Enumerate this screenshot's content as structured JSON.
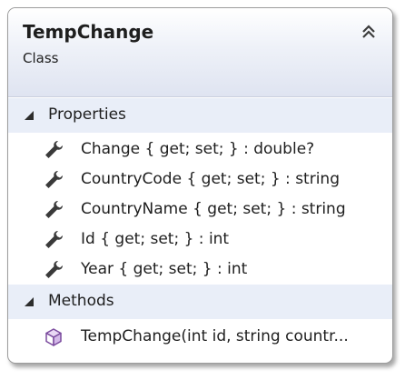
{
  "class": {
    "name": "TempChange",
    "kind": "Class",
    "collapse_icon": "double-chevron-up-icon"
  },
  "sections": {
    "properties": {
      "label": "Properties",
      "items": [
        {
          "text": "Change { get; set; } : double?",
          "icon": "wrench-icon"
        },
        {
          "text": "CountryCode { get; set; } : string",
          "icon": "wrench-icon"
        },
        {
          "text": "CountryName { get; set; } : string",
          "icon": "wrench-icon"
        },
        {
          "text": "Id { get; set; } : int",
          "icon": "wrench-icon"
        },
        {
          "text": "Year { get; set; } : int",
          "icon": "wrench-icon"
        }
      ]
    },
    "methods": {
      "label": "Methods",
      "items": [
        {
          "text": "TempChange(int id, string countr...",
          "icon": "method-cube-icon"
        }
      ]
    }
  }
}
